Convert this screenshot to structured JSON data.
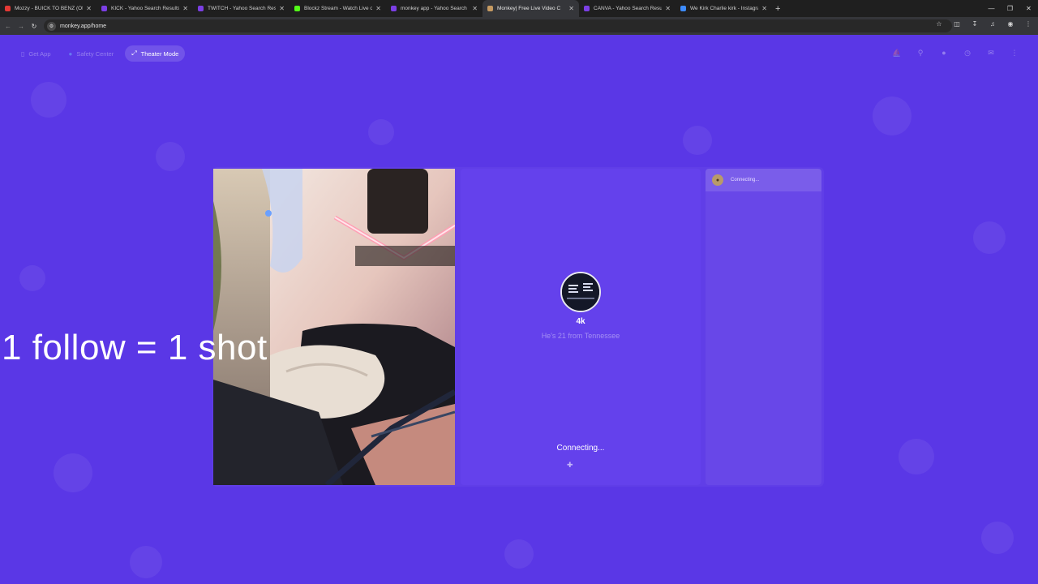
{
  "browser": {
    "tabs": [
      {
        "title": "Mozzy - BUICK TO BENZ (Offic",
        "favicon": "youtube-icon",
        "color": "#e53935",
        "active": false
      },
      {
        "title": "KICK - Yahoo Search Results",
        "favicon": "yahoo-icon",
        "color": "#7b3fe4",
        "active": false
      },
      {
        "title": "TWITCH - Yahoo Search Results",
        "favicon": "yahoo-icon",
        "color": "#7b3fe4",
        "active": false
      },
      {
        "title": "Blockz Stream - Watch Live on",
        "favicon": "kick-icon",
        "color": "#53fc18",
        "active": false
      },
      {
        "title": "monkey app - Yahoo Search Re",
        "favicon": "yahoo-icon",
        "color": "#7b3fe4",
        "active": false
      },
      {
        "title": "Monkey| Free Live Video C",
        "favicon": "monkey-icon",
        "color": "#c59a62",
        "active": true
      },
      {
        "title": "CANVA - Yahoo Search Results",
        "favicon": "yahoo-icon",
        "color": "#7b3fe4",
        "active": false
      },
      {
        "title": "We Kirk Charlie kirk - Instagram",
        "favicon": "chat-icon",
        "color": "#3d8bfd",
        "active": false
      }
    ],
    "url": "monkey.app/home"
  },
  "nav": {
    "get_app": "Get App",
    "safety_center": "Safety Center",
    "theater_mode": "Theater Mode"
  },
  "stranger": {
    "username": "4k",
    "bio": "He's 21 from Tennessee",
    "status": "Connecting..."
  },
  "chat": {
    "status": "Connecting..."
  },
  "overlay": {
    "caption": "1 follow = 1 shot"
  }
}
